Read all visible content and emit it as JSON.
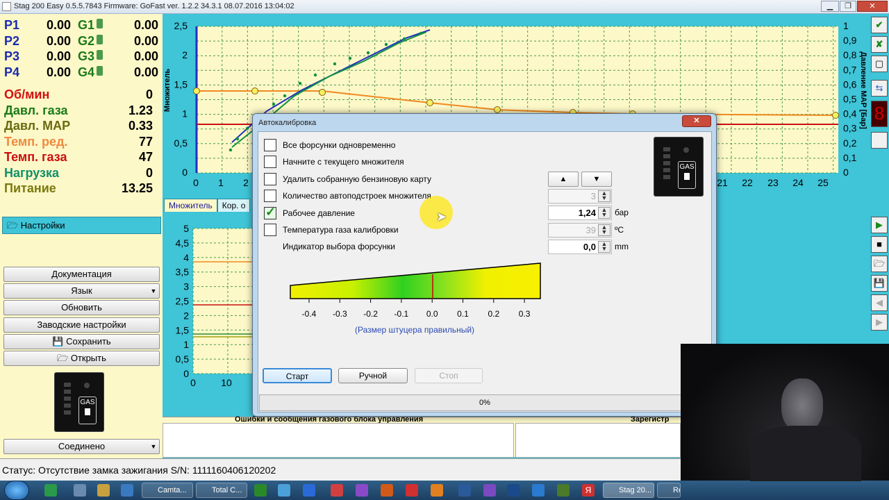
{
  "window": {
    "title": "Stag 200 Easy 0.5.5.7843 Firmware: GoFast  ver. 1.2.2  34.3.1   08.07.2016 13:04:02",
    "min": "▁",
    "max": "❐",
    "close": "✕"
  },
  "params": {
    "rows": [
      {
        "l1": "P1",
        "v1": "0.00",
        "l2": "G1",
        "v2": "0.00"
      },
      {
        "l1": "P2",
        "v1": "0.00",
        "l2": "G2",
        "v2": "0.00"
      },
      {
        "l1": "P3",
        "v1": "0.00",
        "l2": "G3",
        "v2": "0.00"
      },
      {
        "l1": "P4",
        "v1": "0.00",
        "l2": "G4",
        "v2": "0.00"
      }
    ],
    "readings": [
      {
        "label": "Об/мин",
        "value": "0",
        "color": "#d01010"
      },
      {
        "label": "Давл. газа",
        "value": "1.23",
        "color": "#1a7a1a"
      },
      {
        "label": "Давл. MAP",
        "value": "0.33",
        "color": "#6a6a10"
      },
      {
        "label": "Темп. ред.",
        "value": "77",
        "color": "#f08a40"
      },
      {
        "label": "Темп. газа",
        "value": "47",
        "color": "#c81010"
      },
      {
        "label": "Нагрузка",
        "value": "0",
        "color": "#10906a"
      },
      {
        "label": "Питание",
        "value": "13.25",
        "color": "#7a7a10"
      }
    ]
  },
  "menu": {
    "settings": "Настройки",
    "documentation": "Документация",
    "language": "Язык",
    "refresh": "Обновить",
    "factory": "Заводские настройки",
    "save": "Сохранить",
    "open": "Открыть",
    "connected": "Соединено"
  },
  "gas_label": "GAS",
  "tabs": [
    "Множитель",
    "Кор. о"
  ],
  "top_chart": {
    "ylabel_left": "Множитель",
    "ylabel_right": "Давление MAP [Бар]",
    "left_ticks": [
      "2,5",
      "2",
      "1,5",
      "1",
      "0,5",
      "0"
    ],
    "right_ticks": [
      "1",
      "0,9",
      "0,8",
      "0,7",
      "0,6",
      "0,5",
      "0,4",
      "0,3",
      "0,2",
      "0,1",
      "0"
    ],
    "x_ticks_left": [
      "0",
      "1",
      "2"
    ],
    "x_ticks_right": [
      "21",
      "22",
      "23",
      "24",
      "25"
    ]
  },
  "bottom_chart": {
    "left_ticks": [
      "5",
      "4,5",
      "4",
      "3,5",
      "3",
      "2,5",
      "2",
      "1,5",
      "1",
      "0,5",
      "0"
    ],
    "x_ticks": [
      "0",
      "10"
    ]
  },
  "panel_bottom": {
    "errors_title": "Ошибки и сообщения газового блока управления",
    "registered": "Зарегистр"
  },
  "dialog": {
    "title": "Автокалибровка",
    "checkboxes": [
      {
        "label": "Все форсунки одновременно",
        "checked": false
      },
      {
        "label": "Начните с текущего множителя",
        "checked": false
      },
      {
        "label": "Удалить собранную бензиновую карту",
        "checked": false
      },
      {
        "label": "Количество автоподстроек множителя",
        "checked": false
      },
      {
        "label": "Рабочее давление",
        "checked": true
      },
      {
        "label": "Температура газа калибровки",
        "checked": false
      }
    ],
    "indicator_label": "Индикатор выбора форсунки",
    "spins": [
      {
        "value": "3",
        "unit": "",
        "disabled": true
      },
      {
        "value": "1,24",
        "unit": "бар",
        "disabled": false
      },
      {
        "value": "39",
        "unit": "ºC",
        "disabled": true
      },
      {
        "value": "0,0",
        "unit": "mm",
        "disabled": false
      }
    ],
    "up_arrow": "▲",
    "down_arrow": "▼",
    "scale_ticks": [
      "-0.4",
      "-0.3",
      "-0.2",
      "-0.1",
      "0.0",
      "0.1",
      "0.2",
      "0.3"
    ],
    "scale_caption": "(Размер штуцера правильный)",
    "start": "Старт",
    "manual": "Ручной",
    "stop": "Стоп",
    "progress_text": "0%",
    "progress": 0
  },
  "status": "Статус: Отсутствие замка зажигания S/N: 1111160406120202",
  "taskbar": {
    "apps": [
      "Camta...",
      "Total C...",
      "Stag 20...",
      "Re"
    ],
    "lang": "Я"
  },
  "colors": {
    "panel_bg": "#fdf8c8",
    "app_bg": "#3fc4d8",
    "series_blue": "#2030c0",
    "series_green": "#109040",
    "series_orange": "#f08a20",
    "series_red": "#c81010"
  }
}
